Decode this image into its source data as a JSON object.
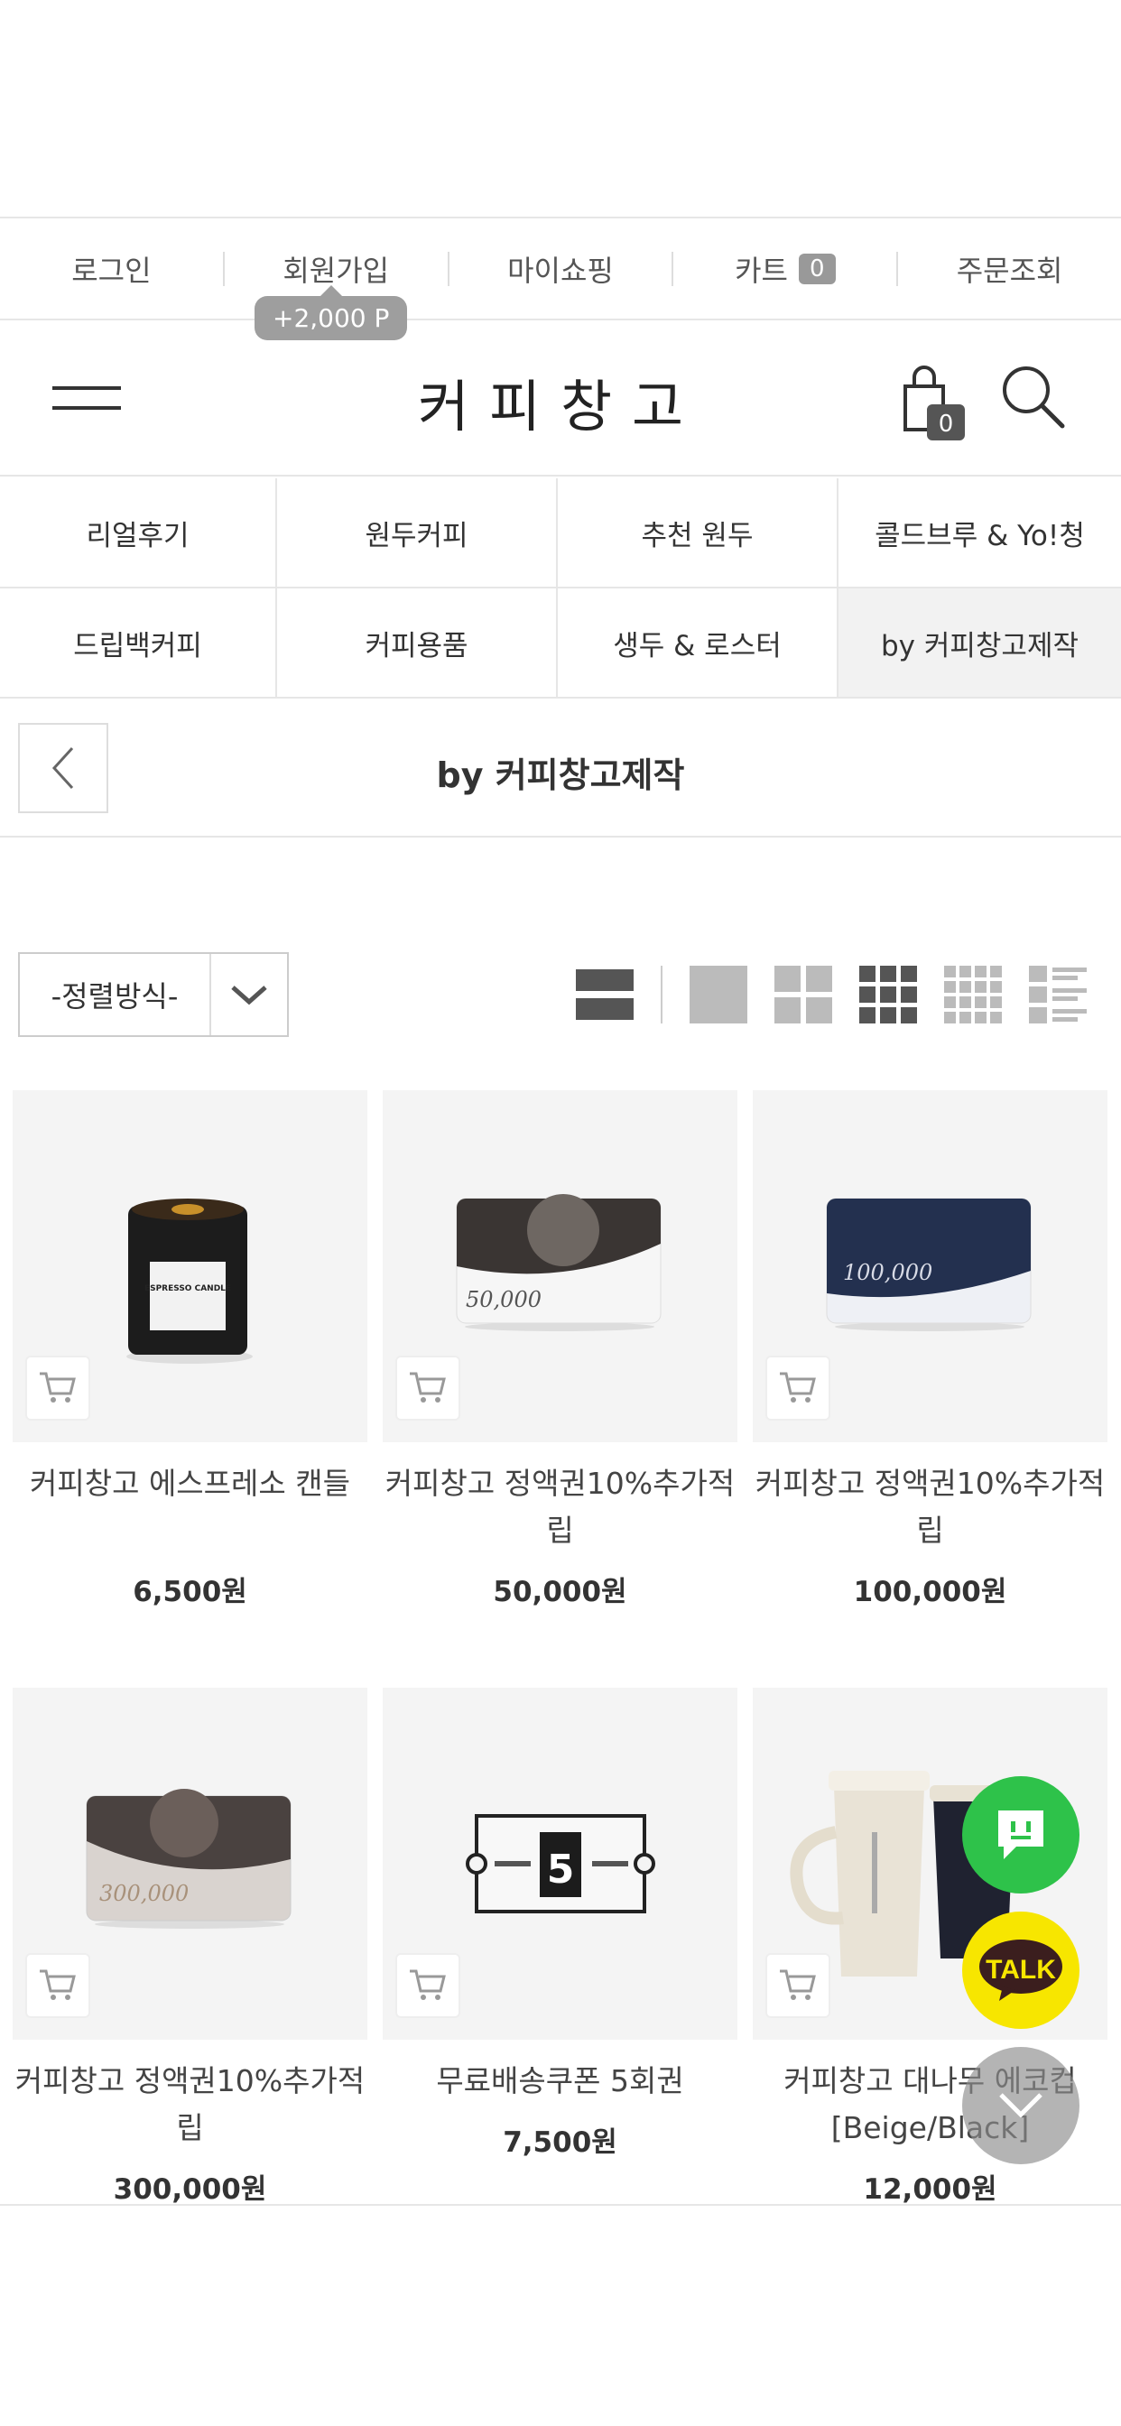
{
  "topbar": {
    "login": "로그인",
    "join": "회원가입",
    "points_tip": "+2,000 P",
    "mypage": "마이쇼핑",
    "cart": "카트",
    "cart_count": "0",
    "order_lookup": "주문조회"
  },
  "header": {
    "logo": "커피창고",
    "bag_count": "0"
  },
  "categories": [
    {
      "label": "리얼후기"
    },
    {
      "label": "원두커피"
    },
    {
      "label": "추천 원두"
    },
    {
      "label": "콜드브루 & Yo!청"
    },
    {
      "label": "드립백커피"
    },
    {
      "label": "커피용품"
    },
    {
      "label": "생두 & 로스터"
    },
    {
      "label": "by 커피창고제작",
      "active": true
    }
  ],
  "page": {
    "title": "by 커피창고제작"
  },
  "toolbar": {
    "sort_label": "-정렬방식-",
    "view_modes": [
      "list-large-icon",
      "grid-1-icon",
      "grid-2-icon",
      "grid-3-icon",
      "grid-4-icon",
      "list-icon"
    ],
    "active_view": "grid-3-icon"
  },
  "products": [
    {
      "name": "커피창고 에스프레소 캔들",
      "price": "6,500원",
      "image": "candle",
      "label_text": "ESPRESSO CANDLE"
    },
    {
      "name": "커피창고 정액권10%추가적립",
      "price": "50,000원",
      "image": "gift-card-50000",
      "card_value": "50,000"
    },
    {
      "name": "커피창고 정액권10%추가적립",
      "price": "100,000원",
      "image": "gift-card-100000",
      "card_value": "100,000"
    },
    {
      "name": "커피창고 정액권10%추가적립",
      "price": "300,000원",
      "image": "gift-card-300000",
      "card_value": "300,000"
    },
    {
      "name": "무료배송쿠폰 5회권",
      "price": "7,500원",
      "image": "shipping-coupon",
      "coupon_digit": "5"
    },
    {
      "name": "커피창고 대나무 에코컵 [Beige/Black]",
      "price": "12,000원",
      "image": "eco-cup"
    }
  ],
  "floating": {
    "talk_label": "TALK"
  },
  "colors": {
    "accent_gray": "#999999",
    "chat_green": "#2ec24a",
    "talk_yellow": "#f7e600"
  }
}
